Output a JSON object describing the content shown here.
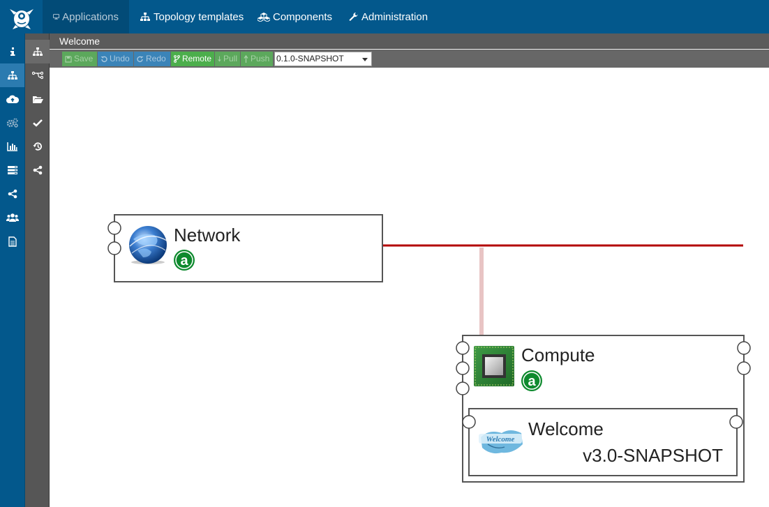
{
  "topnav": {
    "logo": "alien4cloud-logo",
    "items": [
      {
        "label": "Applications",
        "icon": "desktop-icon",
        "active": true
      },
      {
        "label": "Topology templates",
        "icon": "sitemap-icon"
      },
      {
        "label": "Components",
        "icon": "cubes-icon"
      },
      {
        "label": "Administration",
        "icon": "wrench-icon"
      }
    ]
  },
  "sidebar_primary": [
    {
      "icon": "info-icon"
    },
    {
      "icon": "sitemap-icon",
      "active": true
    },
    {
      "icon": "cloud-upload-icon"
    },
    {
      "icon": "gears-icon"
    },
    {
      "icon": "bar-chart-icon"
    },
    {
      "icon": "list-icon"
    },
    {
      "icon": "share-icon"
    },
    {
      "icon": "users-icon"
    },
    {
      "icon": "file-icon"
    }
  ],
  "sidebar_secondary": [
    {
      "icon": "sitemap-icon",
      "active": true
    },
    {
      "icon": "code-fork-icon"
    },
    {
      "icon": "folder-open-icon"
    },
    {
      "icon": "check-icon"
    },
    {
      "icon": "history-icon"
    },
    {
      "icon": "share-alt-icon"
    }
  ],
  "breadcrumb": "Welcome",
  "toolbar": {
    "save": "Save",
    "undo": "Undo",
    "redo": "Redo",
    "remote": "Remote",
    "pull": "Pull",
    "push": "Push",
    "version": "0.1.0-SNAPSHOT"
  },
  "topology": {
    "network": {
      "name": "Network",
      "badge": "a"
    },
    "compute": {
      "name": "Compute",
      "badge": "a"
    },
    "welcome": {
      "name": "Welcome",
      "version": "v3.0-SNAPSHOT",
      "logo_text": "Welcome"
    }
  },
  "colors": {
    "nav_bg": "#03588c",
    "relationship_line": "#b30000",
    "hosted_on_line": "#e8c4c4",
    "badge_green": "#0e8a2e"
  }
}
